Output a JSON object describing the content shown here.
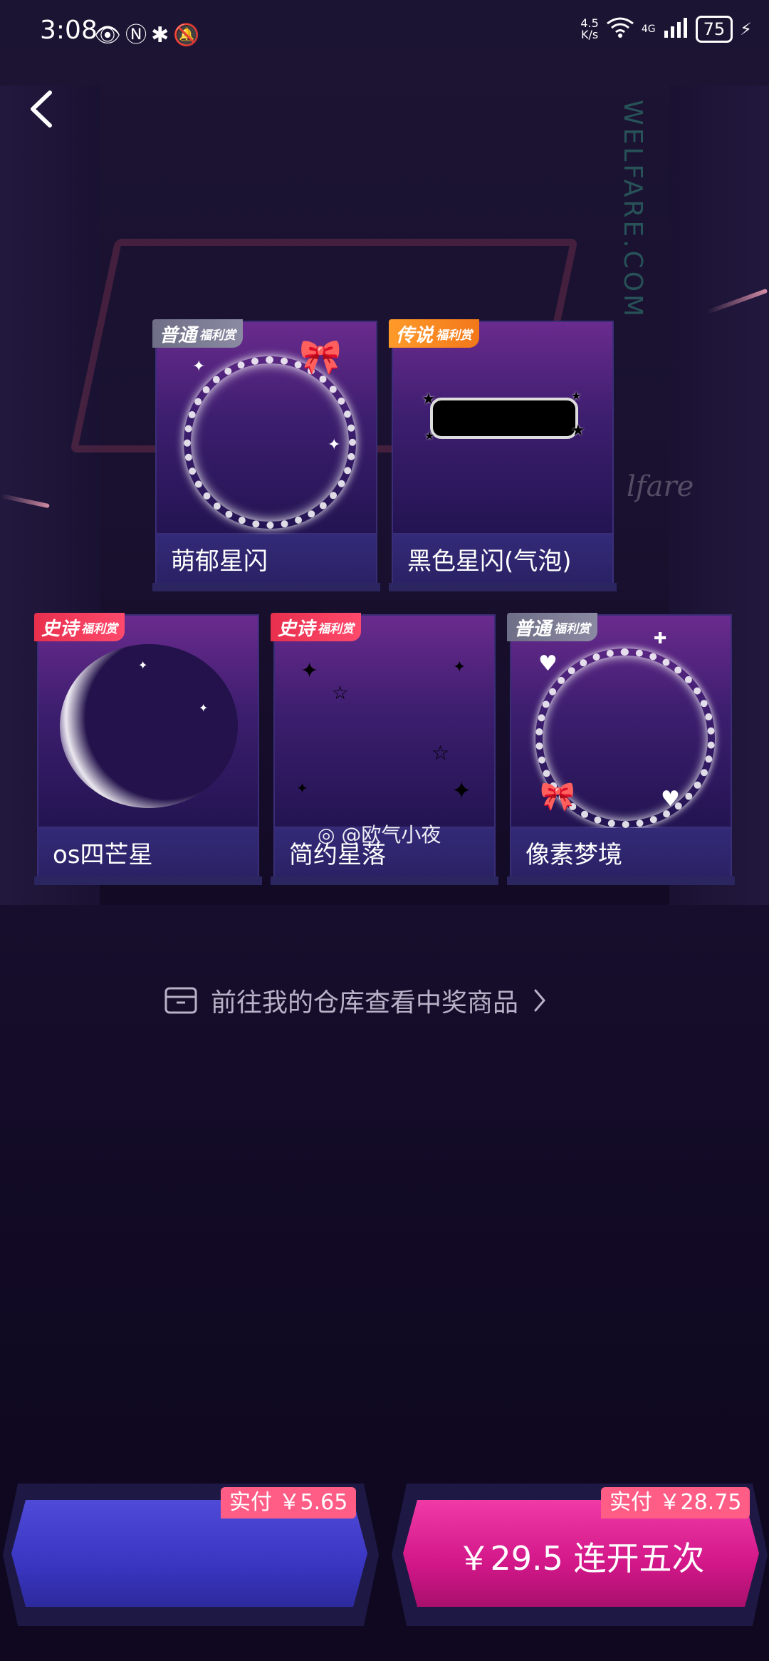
{
  "status_bar": {
    "time": "3:08",
    "net_speed_top": "4.5",
    "net_speed_bottom": "K/s",
    "network": "4G",
    "battery": "75"
  },
  "background": {
    "vertical_text": "WELFARE.COM",
    "script_text": "lfare"
  },
  "prizes": [
    {
      "rarity": "普通",
      "tag": "福利赏",
      "name": "萌郁星闪",
      "style": "normal"
    },
    {
      "rarity": "传说",
      "tag": "福利赏",
      "name": "黑色星闪(气泡)",
      "style": "legend"
    },
    {
      "rarity": "史诗",
      "tag": "福利赏",
      "name": "os四芒星",
      "style": "epic"
    },
    {
      "rarity": "史诗",
      "tag": "福利赏",
      "name": "简约星落",
      "style": "epic"
    },
    {
      "rarity": "普通",
      "tag": "福利赏",
      "name": "像素梦境",
      "style": "normal"
    }
  ],
  "watermark": "@欧气小夜",
  "warehouse_link": "前往我的仓库查看中奖商品",
  "buttons": {
    "left_price_tag": "实付 ￥5.65",
    "right_label": "￥29.5 连开五次",
    "right_price_tag": "实付 ￥28.75"
  },
  "colors": {
    "normal_badge": "#7a7a92",
    "legend_badge": "#f58a22",
    "epic_badge": "#f03c5c",
    "left_button": "#4541cf",
    "right_button": "#e02296",
    "price_tag": "#ff5d86"
  }
}
